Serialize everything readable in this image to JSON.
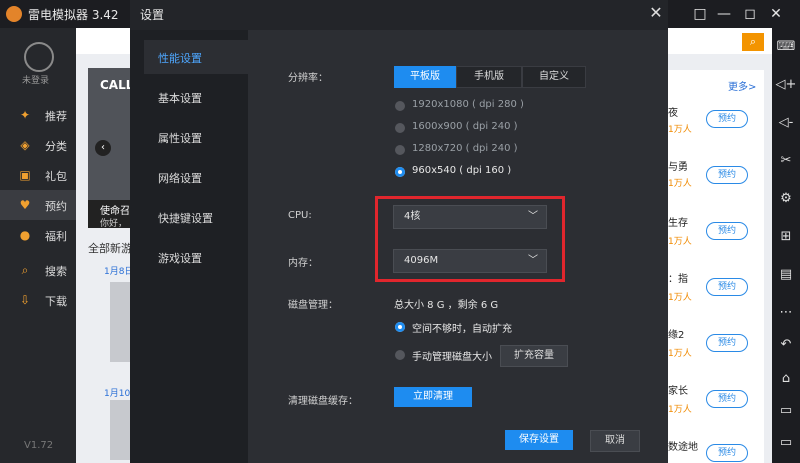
{
  "emulator": {
    "title": "雷电模拟器 3.42",
    "window_controls": [
      "□",
      "—",
      "◻",
      "✕"
    ]
  },
  "sidebar": {
    "login": "未登录",
    "items": [
      {
        "label": "推荐",
        "icon": "gamepad-icon"
      },
      {
        "label": "分类",
        "icon": "layers-icon"
      },
      {
        "label": "礼包",
        "icon": "gift-icon"
      },
      {
        "label": "预约",
        "icon": "heart-icon"
      },
      {
        "label": "福利",
        "icon": "coin-icon"
      },
      {
        "label": "搜索",
        "icon": "search-icon"
      },
      {
        "label": "下载",
        "icon": "download-icon"
      }
    ],
    "version": "V1.72"
  },
  "background": {
    "banner_title": "CALL",
    "banner_caption": "使命召",
    "banner_sub": "你好，",
    "section_title": "全部新游",
    "dates": [
      "1月8日",
      "1月10"
    ],
    "more": "更多>",
    "right_list": [
      {
        "title": "夜",
        "sub": "1万人",
        "btn": "预约"
      },
      {
        "title": "与勇",
        "sub": "1万人",
        "btn": "预约"
      },
      {
        "title": "生存",
        "sub": "1万人",
        "btn": "预约"
      },
      {
        "title": "：指",
        "sub": "1万人",
        "btn": "预约"
      },
      {
        "title": "缘2",
        "sub": "1万人",
        "btn": "预约"
      },
      {
        "title": "家长",
        "sub": "1万人",
        "btn": "预约"
      },
      {
        "title": "数途地",
        "sub": "",
        "btn": "预约"
      }
    ]
  },
  "dialog": {
    "title": "设置",
    "nav": [
      "性能设置",
      "基本设置",
      "属性设置",
      "网络设置",
      "快捷键设置",
      "游戏设置"
    ],
    "resolution_label": "分辨率：",
    "resolution_tabs": [
      "平板版",
      "手机版",
      "自定义"
    ],
    "resolution_options": [
      "1920x1080 ( dpi 280 )",
      "1600x900 ( dpi 240 )",
      "1280x720 ( dpi 240 )",
      "960x540 ( dpi 160 )"
    ],
    "cpu_label": "CPU:",
    "cpu_value": "4核",
    "memory_label": "内存：",
    "memory_value": "4096M",
    "disk_label": "磁盘管理：",
    "disk_info": "总大小 8 G ，剩余 6 G",
    "disk_option_auto": "空间不够时，自动扩充",
    "disk_option_manual": "手动管理磁盘大小",
    "expand_btn": "扩充容量",
    "cache_label": "清理磁盘缓存：",
    "cache_btn": "立即清理",
    "save_btn": "保存设置",
    "cancel_btn": "取消"
  },
  "colors": {
    "accent": "#1e8cf0",
    "highlight": "#e1262d",
    "brand": "#f39400"
  }
}
